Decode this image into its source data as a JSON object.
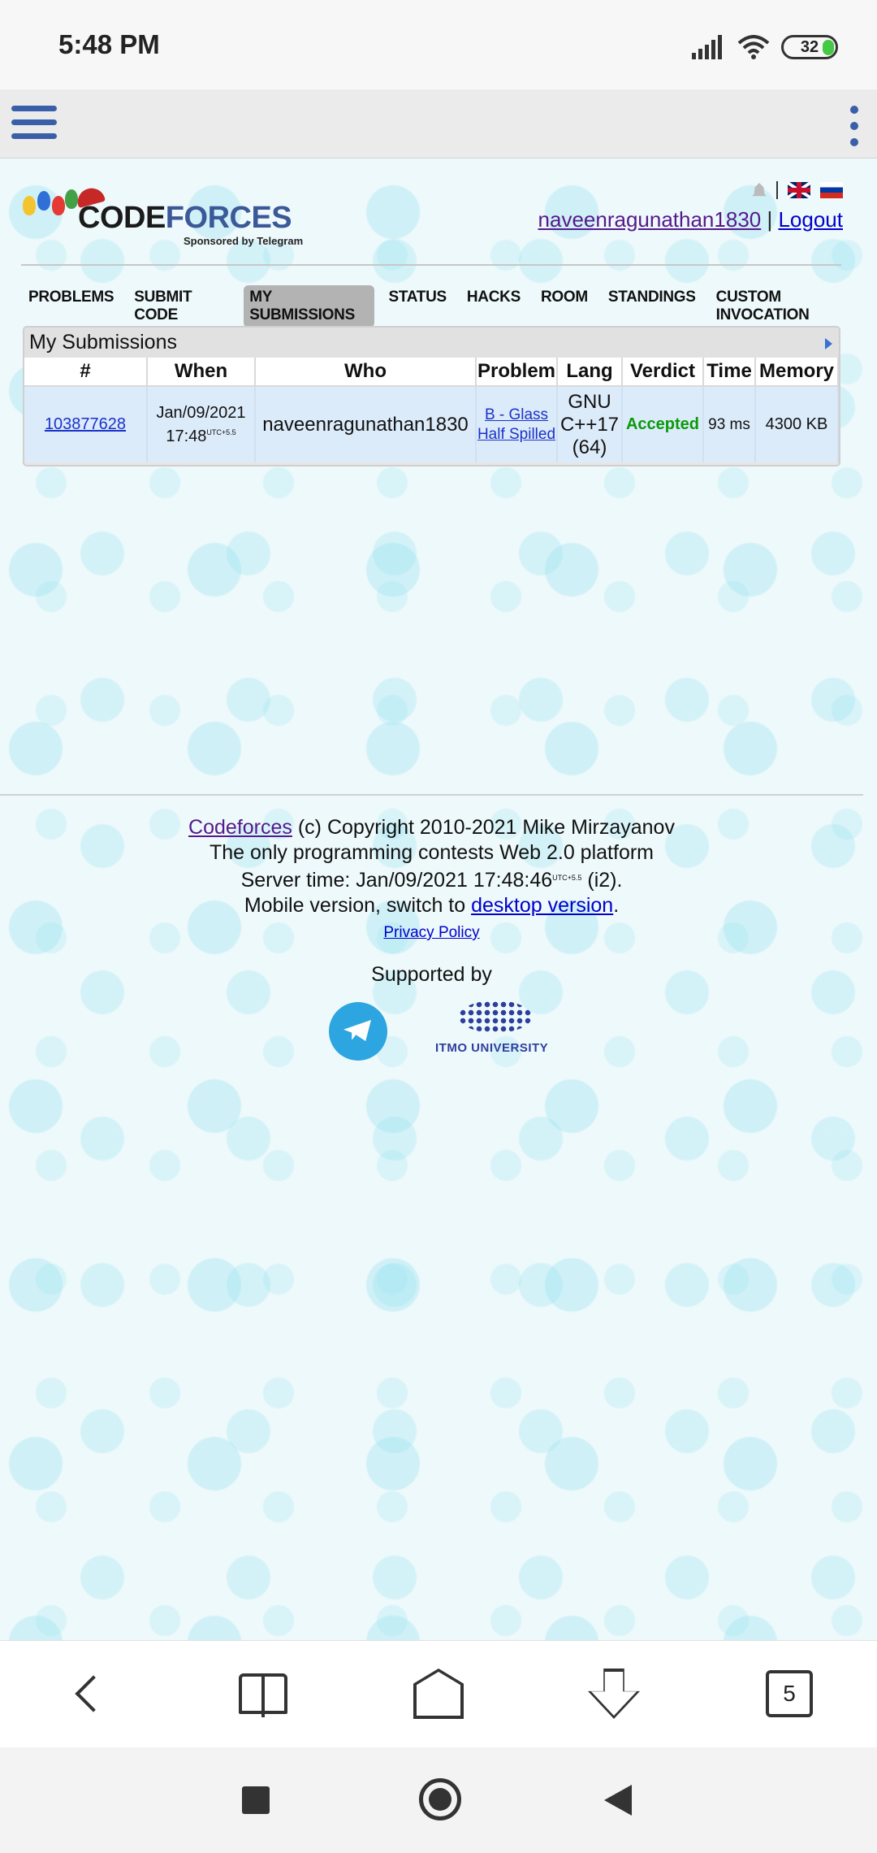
{
  "status": {
    "time": "5:48 PM",
    "battery": "32"
  },
  "header": {
    "logo_text_code": "CODE",
    "logo_text_forces": "FORCES",
    "sponsored": "Sponsored by Telegram",
    "username": "naveenragunathan1830",
    "separator": "|",
    "logout": "Logout"
  },
  "menu": {
    "items": [
      "PROBLEMS",
      "SUBMIT CODE",
      "MY SUBMISSIONS",
      "STATUS",
      "HACKS",
      "ROOM",
      "STANDINGS",
      "CUSTOM INVOCATION"
    ],
    "active": "MY SUBMISSIONS"
  },
  "submissions": {
    "title": "My Submissions",
    "columns": [
      "#",
      "When",
      "Who",
      "Problem",
      "Lang",
      "Verdict",
      "Time",
      "Memory"
    ],
    "rows": [
      {
        "id": "103877628",
        "when_date": "Jan/09/2021",
        "when_time": "17:48",
        "when_tz": "UTC+5.5",
        "who": "naveenragunathan1830",
        "problem": "B - Glass Half Spilled",
        "lang": "GNU C++17 (64)",
        "verdict": "Accepted",
        "time": "93 ms",
        "memory": "4300 KB"
      }
    ]
  },
  "footer": {
    "site_link": "Codeforces",
    "copyright": " (c) Copyright 2010-2021 Mike Mirzayanov",
    "tagline": "The only programming contests Web 2.0 platform",
    "server_time_prefix": "Server time: Jan/09/2021 17:48:46",
    "server_tz": "UTC+5.5",
    "server_suffix": " (i2).",
    "mobile_prefix": "Mobile version, switch to ",
    "desktop_link": "desktop version",
    "mobile_suffix": ".",
    "privacy": "Privacy Policy",
    "supported_by": "Supported by",
    "itmo": "ITMO UNIVERSITY"
  },
  "browser_nav": {
    "tab_count": "5"
  },
  "colors": {
    "accent": "#3a5ea8",
    "accepted": "#0a9a0a",
    "link": "#1a32c9"
  }
}
